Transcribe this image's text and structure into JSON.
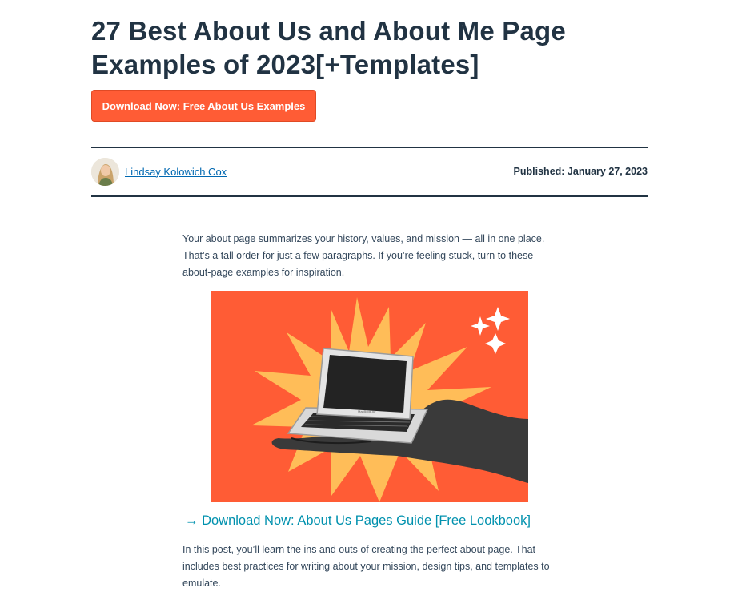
{
  "article": {
    "title": "27 Best About Us and About Me Page Examples of 2023[+Templates]",
    "cta_label": "Download Now: Free About Us Examples",
    "author_name": "Lindsay Kolowich Cox",
    "published": "Published: January 27, 2023",
    "intro": "Your about page summarizes your history, values, and mission — all in one place. That’s a tall order for just a few paragraphs. If you’re feeling stuck, turn to these about-page examples for inspiration.",
    "hero_image": {
      "description_icon": "hand-holding-laptop-illustration",
      "laptop_label": "MacBook Air"
    },
    "guide_link": "→ Download Now: About Us Pages Guide [Free Lookbook]",
    "body": "In this post, you’ll learn the ins and outs of creating the perfect about page. That includes best practices for writing about your mission, design tips, and templates to emulate."
  },
  "colors": {
    "title": "#213343",
    "cta_bg": "#ff5c35",
    "link": "#0091ae",
    "author_link": "#0068b1",
    "hero_bg": "#ff5c35",
    "burst": "#ffbd58"
  }
}
